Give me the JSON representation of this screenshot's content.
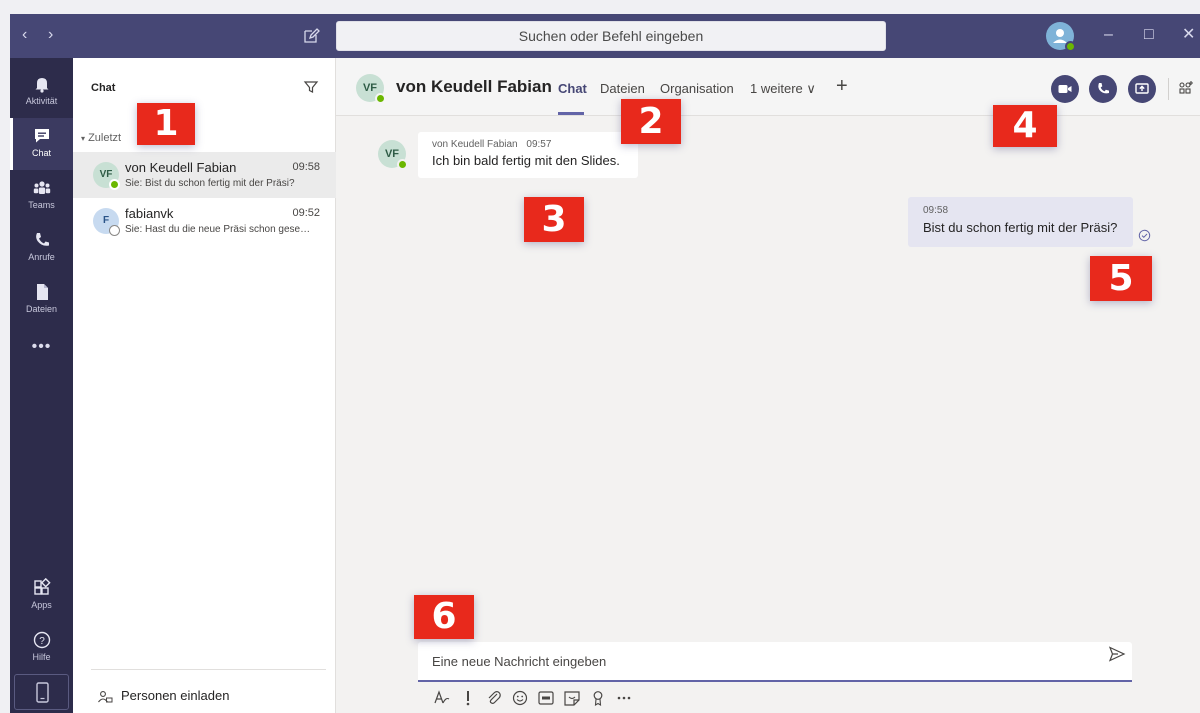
{
  "titlebar": {
    "search_label": "Suchen oder Befehl eingeben"
  },
  "rail": {
    "items": [
      {
        "label": "Aktivität",
        "icon": "bell-icon"
      },
      {
        "label": "Chat",
        "icon": "chat-icon"
      },
      {
        "label": "Teams",
        "icon": "teams-icon"
      },
      {
        "label": "Anrufe",
        "icon": "phone-icon"
      },
      {
        "label": "Dateien",
        "icon": "file-icon"
      },
      {
        "label": "Apps",
        "icon": "apps-icon"
      },
      {
        "label": "Hilfe",
        "icon": "help-icon"
      }
    ],
    "more_label": "•••"
  },
  "chatlist": {
    "title": "Chat",
    "section": "Zuletzt",
    "chats": [
      {
        "initials": "VF",
        "name": "von Keudell Fabian",
        "time": "09:58",
        "preview": "Sie: Bist du schon fertig mit der Präsi?"
      },
      {
        "initials": "F",
        "name": "fabianvk",
        "time": "09:52",
        "preview": "Sie: Hast du die neue Präsi schon gesehen?"
      }
    ],
    "invite_label": "Personen einladen"
  },
  "conversation": {
    "avatar_initials": "VF",
    "name": "von Keudell Fabian",
    "tabs": [
      "Chat",
      "Dateien",
      "Organisation",
      "1 weitere ∨"
    ],
    "add_tab": "+"
  },
  "messages": {
    "incoming": {
      "initials": "VF",
      "sender": "von Keudell Fabian",
      "time": "09:57",
      "text": "Ich bin bald fertig mit den Slides."
    },
    "outgoing": {
      "time": "09:58",
      "text": "Bist du schon fertig mit der Präsi?"
    }
  },
  "compose": {
    "placeholder": "Eine neue Nachricht eingeben"
  },
  "callouts": [
    "1",
    "2",
    "3",
    "4",
    "5",
    "6"
  ],
  "colors": {
    "titlebar": "#464775",
    "rail": "#2d2c4b",
    "accent": "#6264a7",
    "callout": "#e8291c",
    "presence_online": "#6bb700"
  }
}
